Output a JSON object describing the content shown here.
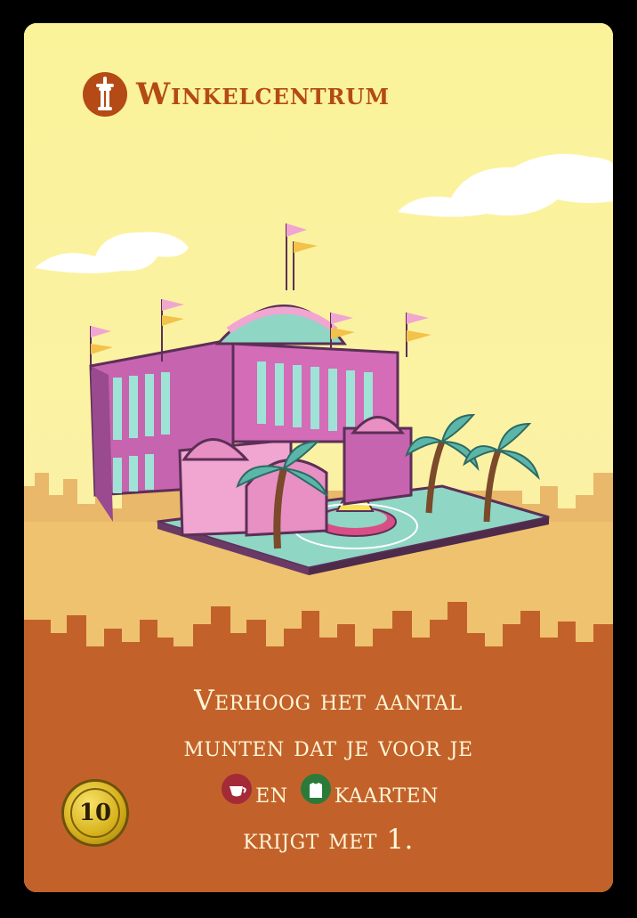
{
  "card": {
    "title": "Winkelcentrum",
    "title_icon": "tower-icon",
    "cost": "10",
    "effect": {
      "line1": "Verhoog het aantal",
      "line2": "munten dat je voor je",
      "line3_word1": "en",
      "line3_word2": "kaarten",
      "line4": "krijgt met 1.",
      "symbol1": "cup-icon",
      "symbol2": "shirt-icon"
    }
  },
  "colors": {
    "title": "#b44a15",
    "sky": "#fbf39a",
    "skyline_back": "#eab86a",
    "skyline_front": "#c2622a",
    "text_panel": "#c2622a",
    "symbol_red": "#a32a36",
    "symbol_green": "#2c7a3a",
    "coin": "#d7b21d"
  }
}
